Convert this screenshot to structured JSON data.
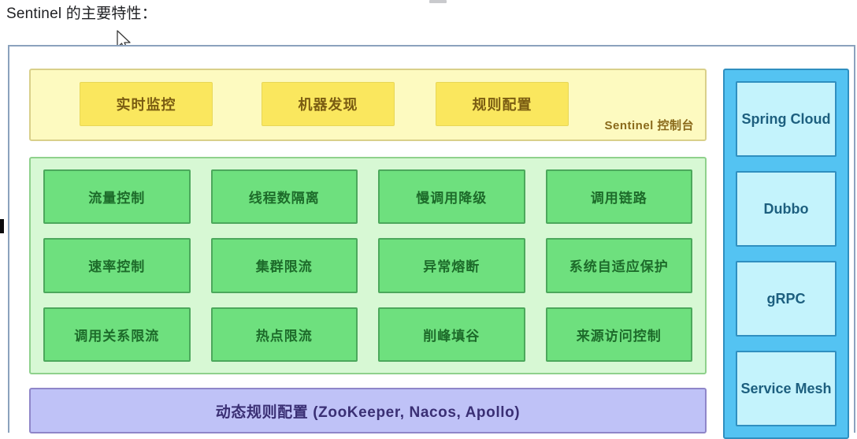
{
  "heading": "Sentinel 的主要特性：",
  "colors": {
    "frame_border": "#8ba2bd",
    "console_bg": "#fdfac0",
    "console_card": "#fae75e",
    "features_bg": "#d7f8d4",
    "feature_card": "#6ee07e",
    "rules_bar": "#bfc2f7",
    "adapters_bg": "#54c3f2",
    "adapter_card": "#c4f3fc"
  },
  "console": {
    "label": "Sentinel 控制台",
    "cards": [
      "实时监控",
      "机器发现",
      "规则配置"
    ]
  },
  "features": {
    "cells": [
      "流量控制",
      "线程数隔离",
      "慢调用降级",
      "调用链路",
      "速率控制",
      "集群限流",
      "异常熔断",
      "系统自适应保护",
      "调用关系限流",
      "热点限流",
      "削峰填谷",
      "来源访问控制"
    ]
  },
  "rules": {
    "label": "动态规则配置 (ZooKeeper, Nacos, Apollo)"
  },
  "adapters": {
    "cells": [
      "Spring\nCloud",
      "Dubbo",
      "gRPC",
      "Service\nMesh"
    ]
  }
}
